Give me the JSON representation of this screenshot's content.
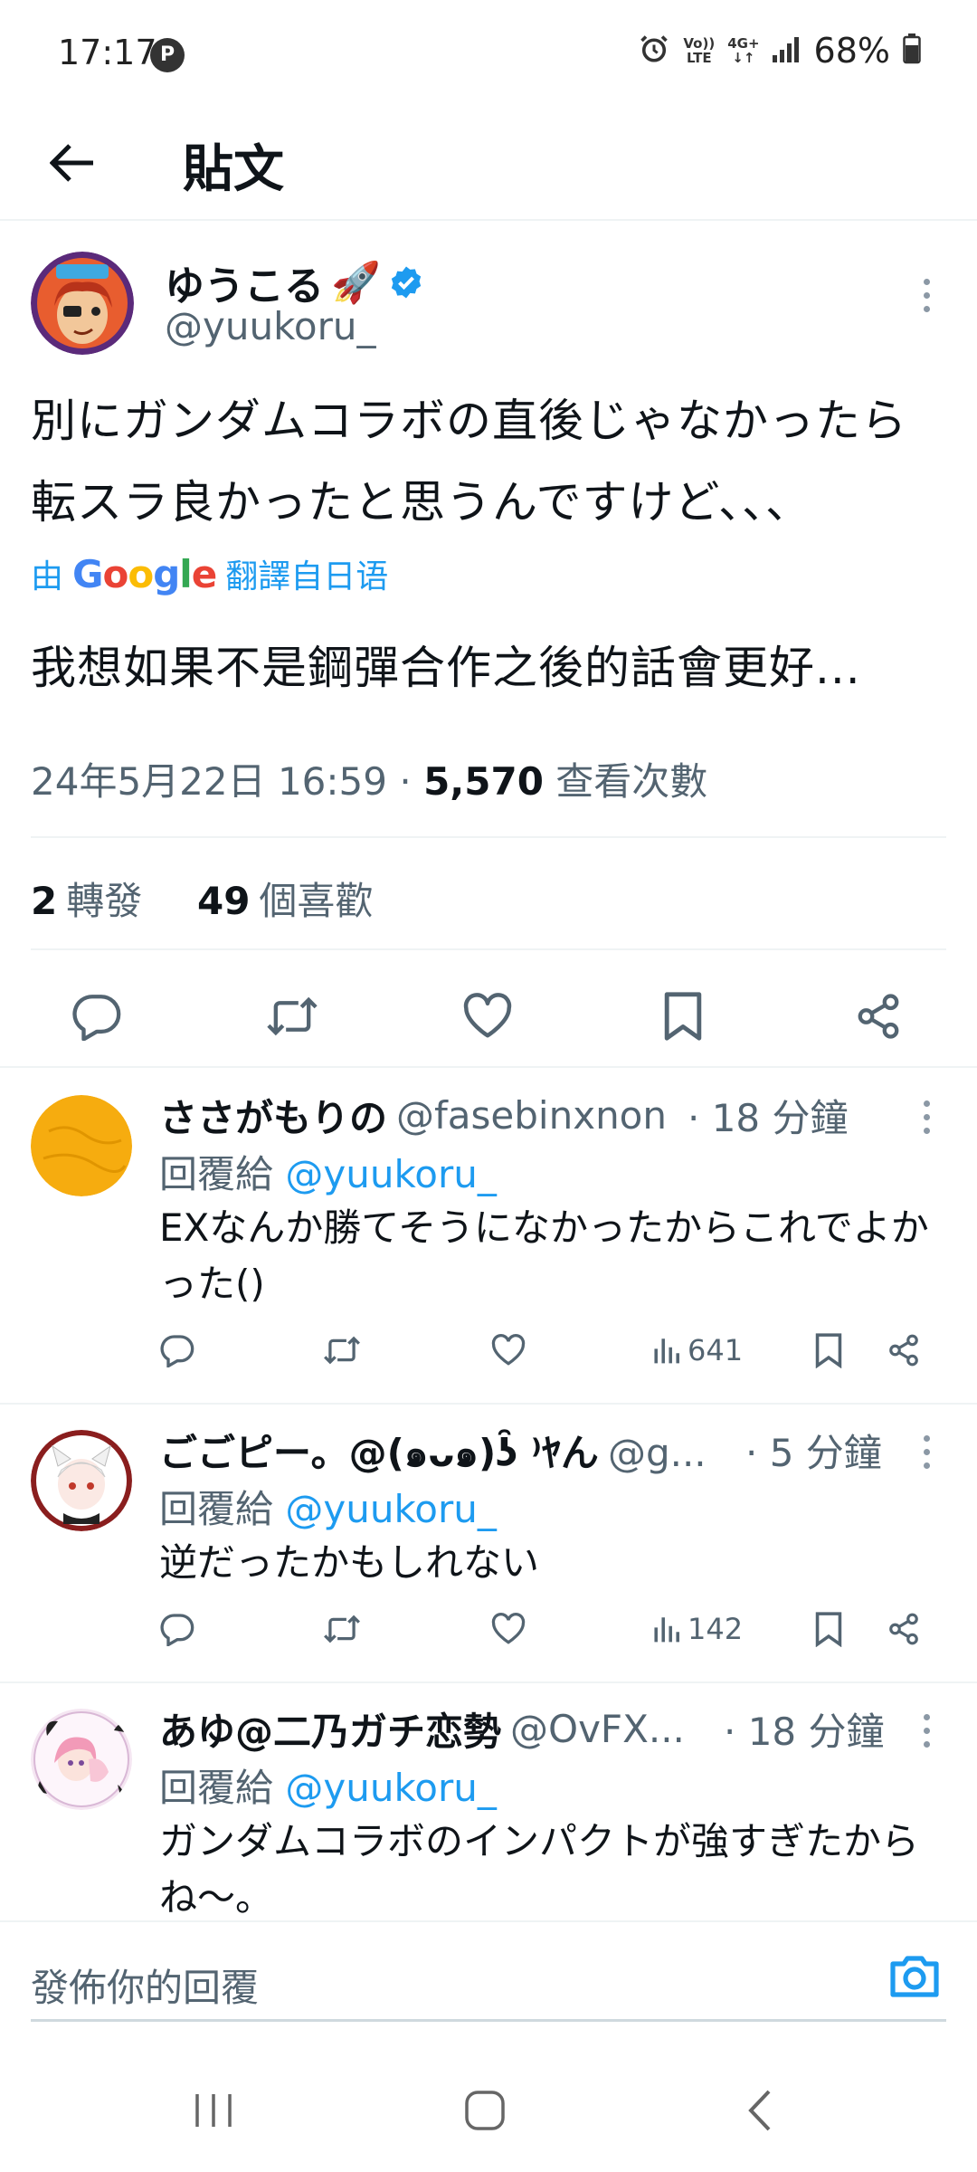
{
  "status_bar": {
    "time": "17:17",
    "p_badge": "P",
    "net_volte_top": "Vo))",
    "net_volte_bottom": "LTE",
    "net_4g": "4G+",
    "battery": "68%"
  },
  "header": {
    "title": "貼文"
  },
  "post": {
    "display_name": "ゆうこる",
    "handle": "@yuukoru_",
    "text_line1": "別にガンダムコラボの直後じゃなかったら",
    "text_line2": "転スラ良かったと思うんですけど、、、",
    "translate_prefix": "由",
    "translate_brand": "Google",
    "translate_suffix": "翻譯自日语",
    "translated_text": "我想如果不是鋼彈合作之後的話會更好...",
    "datetime": "24年5月22日 16:59",
    "separator": "·",
    "views_count": "5,570",
    "views_label": "查看次數",
    "retweets_count": "2",
    "retweets_label": "轉發",
    "likes_count": "49",
    "likes_label": "個喜歡"
  },
  "replies": [
    {
      "name": "ささがもりの",
      "handle": "@fasebinxnon",
      "time": "· 18 分鐘",
      "reply_to_label": "回覆給",
      "reply_to_handle": "@yuukoru_",
      "text": "EXなんか勝てそうになかったからこれでよかった()",
      "views": "641"
    },
    {
      "name": "ごごピー。@(๑ᴗ๑)ʖ̑ ⁾ﾔん",
      "handle": "@g...",
      "time": "· 5 分鐘",
      "reply_to_label": "回覆給",
      "reply_to_handle": "@yuukoru_",
      "text": "逆だったかもしれない",
      "views": "142"
    },
    {
      "name": "あゆ@二乃ガチ恋勢",
      "handle": "@OvFX...",
      "time": "· 18 分鐘",
      "reply_to_label": "回覆給",
      "reply_to_handle": "@yuukoru_",
      "text": "ガンダムコラボのインパクトが強すぎたからね〜。"
    }
  ],
  "compose": {
    "placeholder": "發佈你的回覆"
  },
  "colors": {
    "accent": "#1d9bf0",
    "text_primary": "#0f1419",
    "text_secondary": "#536471",
    "divider": "#eff3f4"
  },
  "icons": {
    "back": "arrow-left-icon",
    "verified": "verified-badge-icon",
    "reply": "comment-icon",
    "retweet": "retweet-icon",
    "like": "heart-icon",
    "bookmark": "bookmark-icon",
    "share": "share-icon",
    "views": "bar-chart-icon",
    "camera": "camera-icon"
  }
}
